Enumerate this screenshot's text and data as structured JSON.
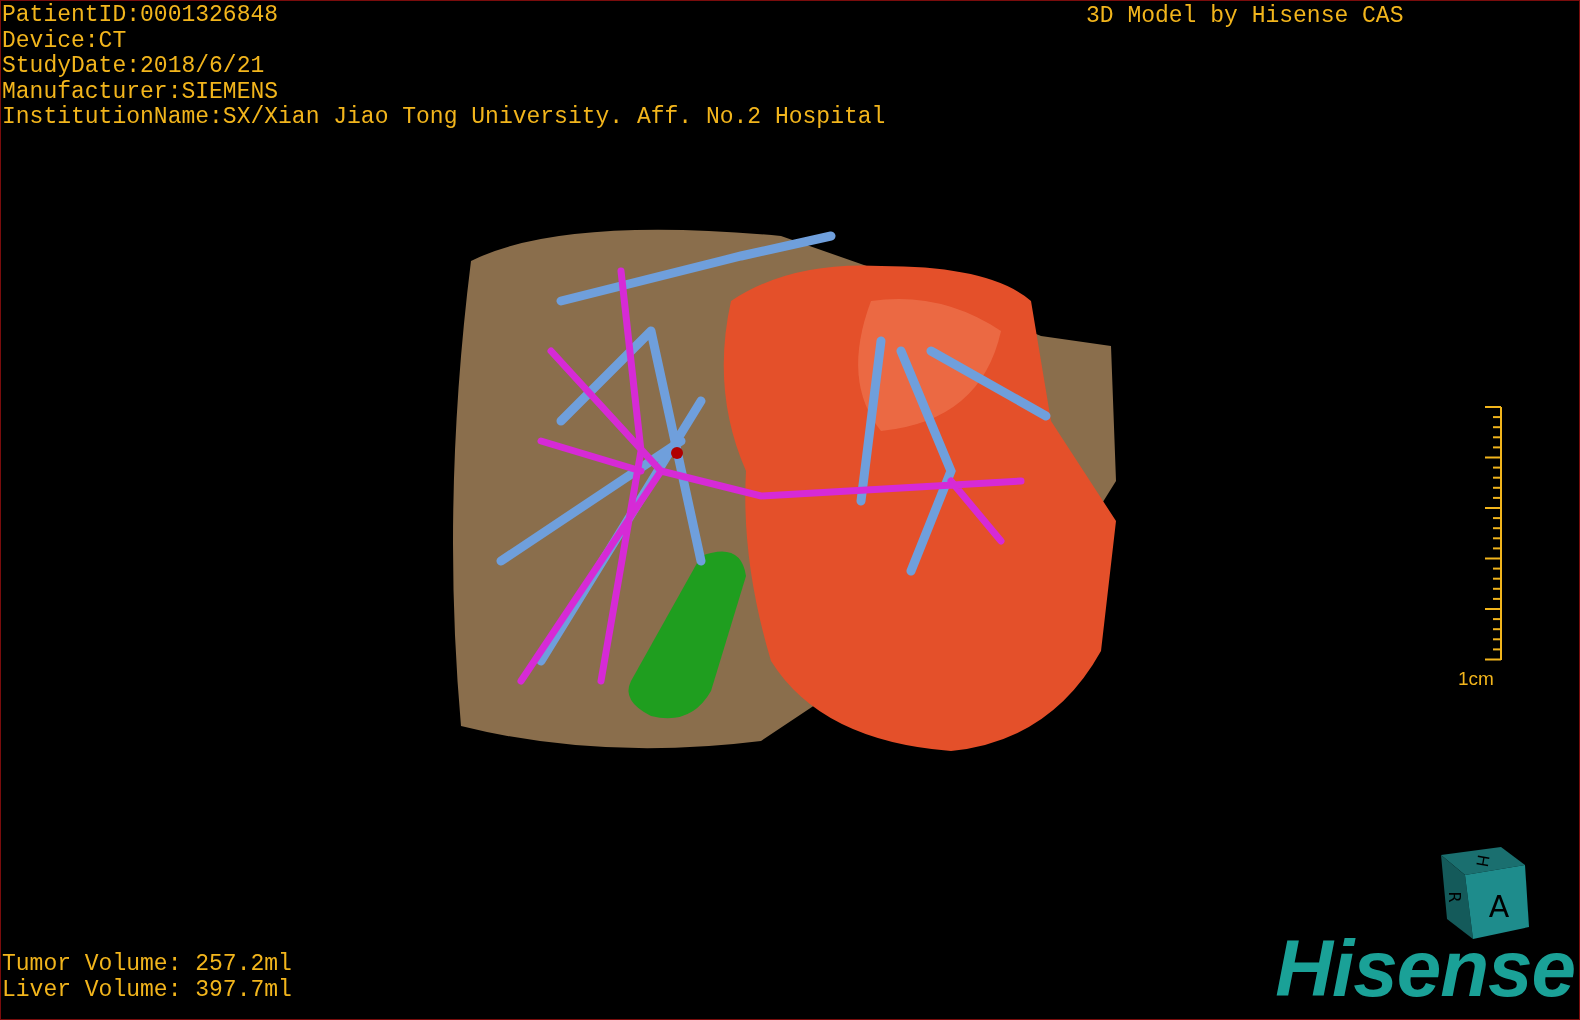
{
  "header_info": [
    "PatientID:0001326848",
    "Device:CT",
    "StudyDate:2018/6/21",
    "Manufacturer:SIEMENS",
    "InstitutionName:SX/Xian Jiao Tong University. Aff. No.2 Hospital"
  ],
  "title": "3D Model by Hisense CAS",
  "scale_bar": {
    "label": "1cm"
  },
  "orientation_cube": {
    "top": "H",
    "left": "R",
    "front": "A"
  },
  "volumes": [
    "Tumor Volume: 257.2ml",
    "Liver Volume: 397.7ml"
  ],
  "logo": "Hisense"
}
